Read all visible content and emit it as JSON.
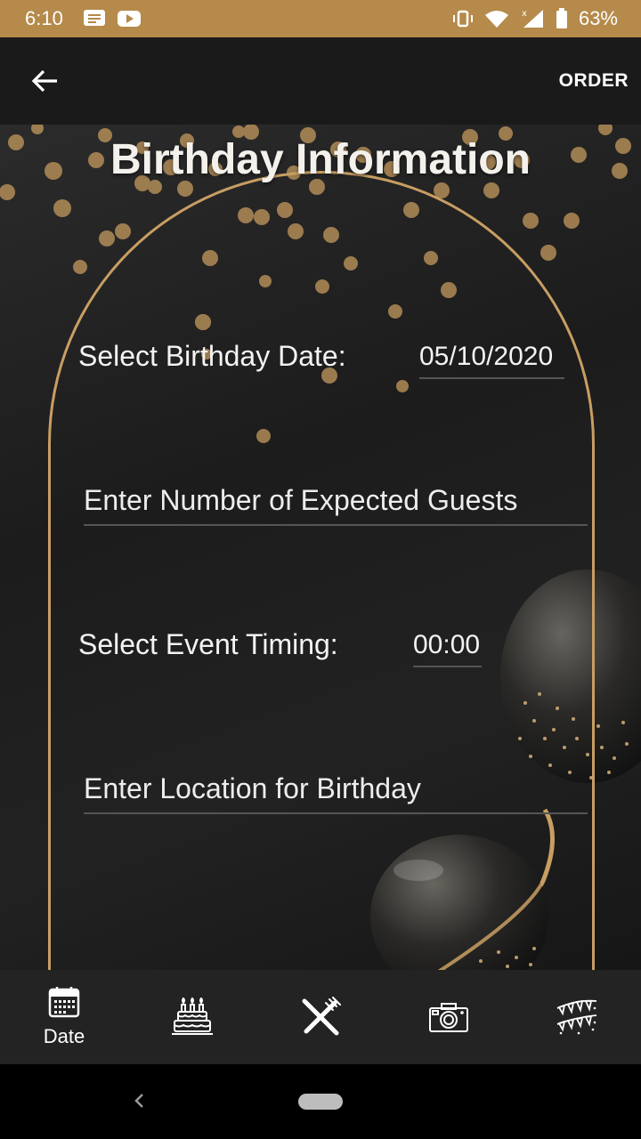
{
  "status_bar": {
    "time": "6:10",
    "battery": "63%",
    "icons": [
      "message-icon",
      "youtube-icon",
      "vibrate-icon",
      "wifi-icon",
      "signal-icon",
      "battery-icon"
    ]
  },
  "app_bar": {
    "order_label": "ORDER"
  },
  "page": {
    "title": "Birthday Information"
  },
  "form": {
    "date_label": "Select Birthday Date:",
    "date_value": "05/10/2020",
    "guests_placeholder": "Enter Number of Expected Guests",
    "timing_label": "Select Event Timing:",
    "timing_value": "00:00",
    "location_placeholder": "Enter Location for Birthday"
  },
  "bottom_nav": {
    "items": [
      {
        "icon": "calendar-icon",
        "label": "Date"
      },
      {
        "icon": "cake-icon",
        "label": ""
      },
      {
        "icon": "utensils-icon",
        "label": ""
      },
      {
        "icon": "camera-icon",
        "label": ""
      },
      {
        "icon": "bunting-icon",
        "label": ""
      }
    ]
  },
  "colors": {
    "status_bar": "#b58a4a",
    "app_bar": "#1a1a1a",
    "gold_accent": "#c89e62",
    "bottom_nav": "#232323"
  }
}
